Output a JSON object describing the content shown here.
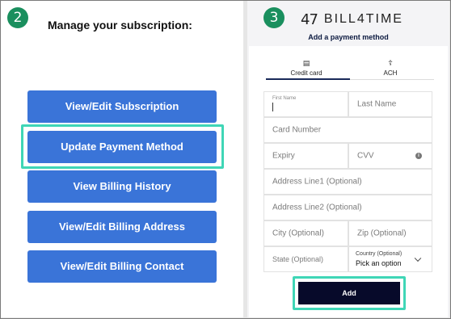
{
  "left": {
    "step": "2",
    "title": "Manage your subscription:",
    "buttons": [
      "View/Edit Subscription",
      "Update Payment Method",
      "View Billing History",
      "View/Edit Billing Address",
      "View/Edit Billing Contact"
    ]
  },
  "right": {
    "step": "3",
    "brand": {
      "mark": "47",
      "name": "BILL4TIME"
    },
    "title": "Add a payment method",
    "tabs": {
      "card": "Credit card",
      "ach": "ACH"
    },
    "fields": {
      "first_name_label": "First Name",
      "last_name": "Last Name",
      "card_number": "Card Number",
      "expiry": "Expiry",
      "cvv": "CVV",
      "address1": "Address Line1 (Optional)",
      "address2": "Address Line2 (Optional)",
      "city": "City (Optional)",
      "zip": "Zip (Optional)",
      "state": "State (Optional)",
      "country_label": "Country (Optional)",
      "country_value": "Pick an option"
    },
    "add_label": "Add"
  },
  "icons": {
    "card": "credit-card-icon",
    "ach": "bank-icon",
    "info": "info-icon",
    "chevron": "chevron-down-icon"
  },
  "colors": {
    "button_blue": "#3a74d8",
    "highlight": "#3fd6b6",
    "step_badge": "#1a8f5e",
    "add_button": "#070a2a"
  }
}
